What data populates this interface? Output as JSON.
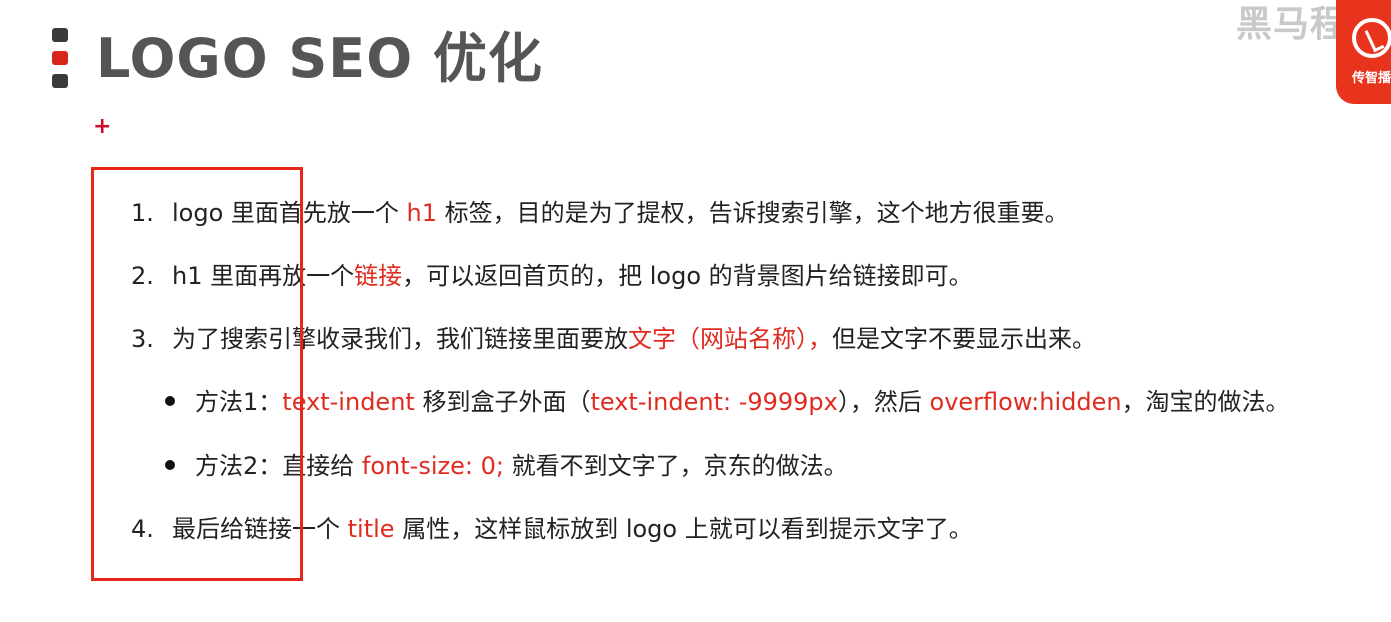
{
  "title": "LOGO SEO 优化",
  "plus": "+",
  "logo": {
    "text": "黑马程序",
    "small": "传智播",
    "icon": "brand-logo-icon"
  },
  "colors": {
    "accent": "#e02c20",
    "title": "#555555",
    "box": "#e8251a"
  },
  "items": [
    {
      "num": "1.",
      "parts": [
        "logo 里面首先放一个 ",
        "h1",
        " 标签，目的是为了提权，告诉搜索引擎，这个地方很重要。"
      ]
    },
    {
      "num": "2.",
      "parts": [
        "h1 里面再放一个",
        "链接",
        "，可以返回首页的，把 logo 的背景图片给链接即可。"
      ]
    },
    {
      "num": "3.",
      "parts": [
        "为了搜索引擎收录我们，我们链接里面要放",
        "文字（网站名称），",
        "但是文字不要显示出来。"
      ]
    },
    {
      "num": "4.",
      "parts": [
        "最后给链接一个 ",
        "title",
        " 属性，这样鼠标放到 logo 上就可以看到提示文字了。"
      ]
    }
  ],
  "methods": [
    {
      "parts": [
        "方法1：",
        "text-indent",
        " 移到盒子外面（",
        "text-indent: -9999px",
        "），然后 ",
        "overflow:hidden",
        "，淘宝的做法。"
      ]
    },
    {
      "parts": [
        "方法2：直接给 ",
        "font-size: 0;",
        " 就看不到文字了，京东的做法。"
      ]
    }
  ]
}
